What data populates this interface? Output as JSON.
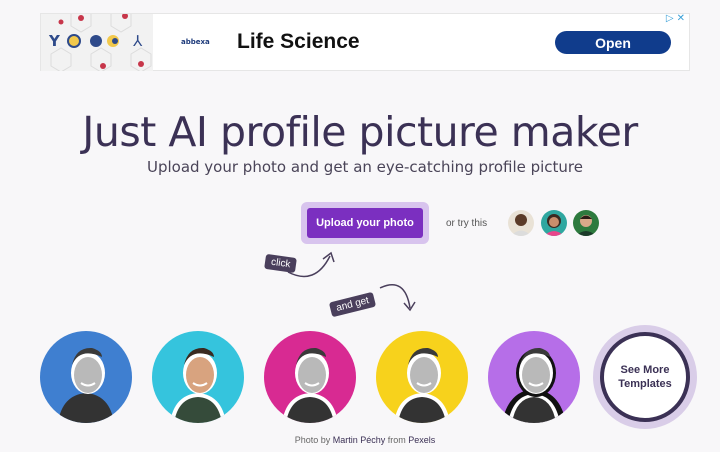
{
  "ad": {
    "brand": "abbexa",
    "title": "Life Science",
    "cta": "Open"
  },
  "hero": {
    "title": "Just AI profile picture maker",
    "subtitle": "Upload your photo and get an eye-catching profile picture"
  },
  "upload": {
    "button_label": "Upload your photo",
    "or_try": "or try this"
  },
  "hints": {
    "click": "click",
    "and_get": "and get"
  },
  "templates": {
    "see_more": "See More Templates",
    "items": [
      {
        "bg": "#3f7fd0"
      },
      {
        "bg": "#35c4dd"
      },
      {
        "bg": "#d82a92"
      },
      {
        "bg": "#f7d21c"
      },
      {
        "bg": "#b66ee8"
      }
    ]
  },
  "credit": {
    "prefix": "Photo by",
    "author": "Martin Péchy",
    "middle": "from",
    "source": "Pexels"
  },
  "colors": {
    "accent": "#7b2fc0",
    "title": "#3b3155",
    "ad_button": "#103c8c"
  }
}
